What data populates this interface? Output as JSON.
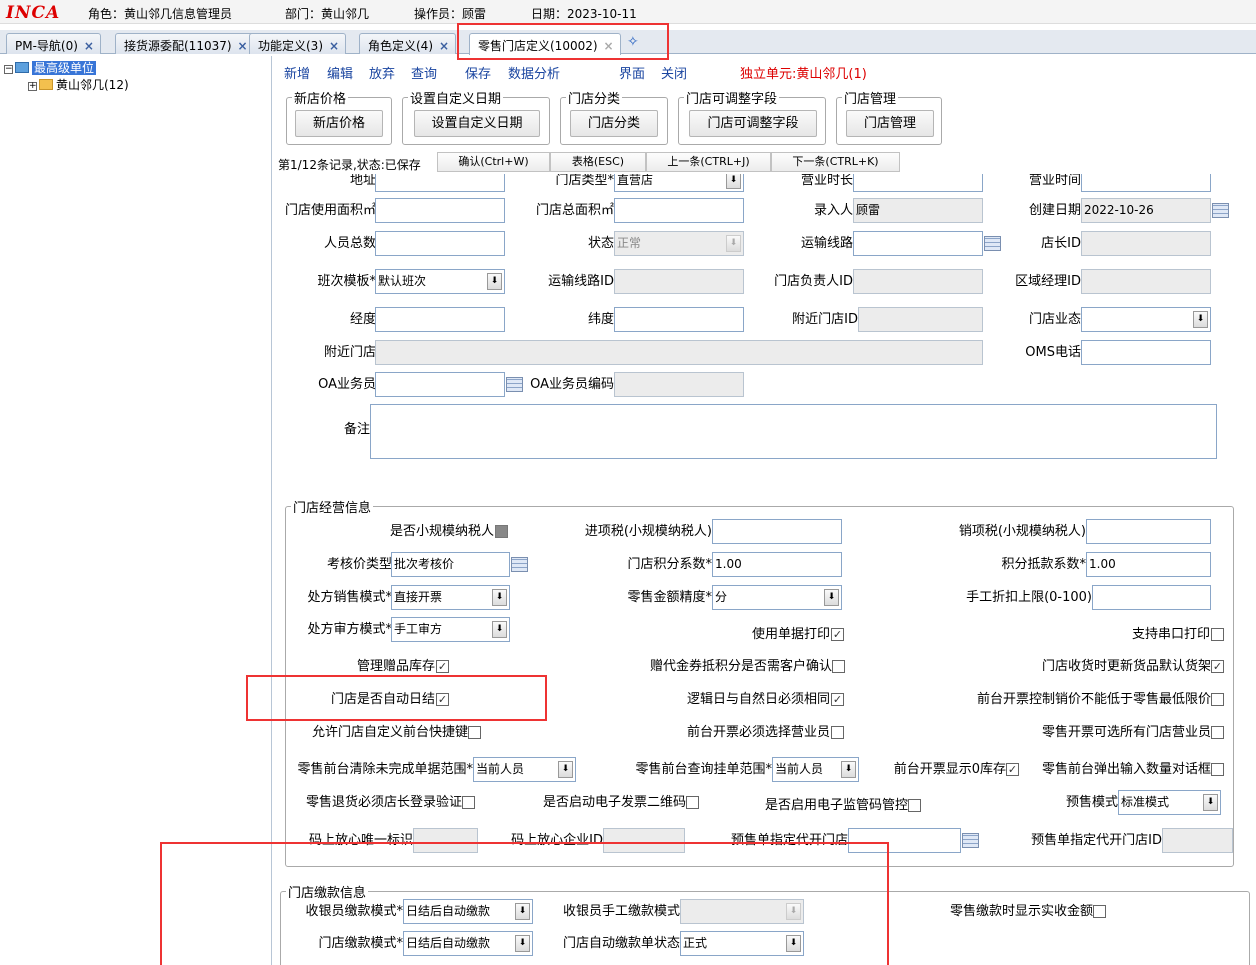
{
  "header": {
    "logo": "INCA",
    "role": "角色：黄山邻几信息管理员",
    "dept": "部门：黄山邻几",
    "operator": "操作员：顾雷",
    "date": "日期：2023-10-11"
  },
  "tabs": [
    {
      "label": "PM-导航(0)"
    },
    {
      "label": "接货源委配(11037)"
    },
    {
      "label": "功能定义(3)"
    },
    {
      "label": "角色定义(4)"
    },
    {
      "label": "零售门店定义(10002)"
    }
  ],
  "tab_close": "×",
  "add_tab": "✧",
  "tree": {
    "root": "最高级单位",
    "child": "黄山邻几(12)",
    "expand_root": "−",
    "expand_child": "+"
  },
  "toolbar": {
    "items": [
      "新增",
      "编辑",
      "放弃",
      "查询",
      "保存",
      "数据分析",
      "界面",
      "关闭"
    ],
    "unit": "独立单元:黄山邻几(1)"
  },
  "groups": [
    {
      "legend": "新店价格",
      "button": "新店价格"
    },
    {
      "legend": "设置自定义日期",
      "button": "设置自定义日期"
    },
    {
      "legend": "门店分类",
      "button": "门店分类"
    },
    {
      "legend": "门店可调整字段",
      "button": "门店可调整字段"
    },
    {
      "legend": "门店管理",
      "button": "门店管理"
    }
  ],
  "record_bar": {
    "status": "第1/12条记录,状态:已保存",
    "confirm": "确认(Ctrl+W)",
    "table": "表格(ESC)",
    "prev": "上一条(CTRL+J)",
    "next": "下一条(CTRL+K)"
  },
  "basic": {
    "address_label": "地址",
    "store_type_label": "门店类型*",
    "store_type_value": "直营店",
    "hours_label": "营业时长",
    "business_time_label": "营业时间",
    "use_area_label": "门店使用面积㎡",
    "total_area_label": "门店总面积㎡",
    "entered_by_label": "录入人",
    "entered_by_value": "顾雷",
    "created_date_label": "创建日期",
    "created_date_value": "2022-10-26",
    "staff_total_label": "人员总数",
    "state_label": "状态",
    "state_value": "正常",
    "route_label": "运输线路",
    "manager_id_label": "店长ID",
    "shift_template_label": "班次模板*",
    "shift_template_value": "默认班次",
    "route_id_label": "运输线路ID",
    "store_owner_id_label": "门店负责人ID",
    "area_manager_id_label": "区域经理ID",
    "longitude_label": "经度",
    "latitude_label": "纬度",
    "nearby_store_id_label": "附近门店ID",
    "store_status_label": "门店业态",
    "nearby_store_label": "附近门店",
    "oms_phone_label": "OMS电话",
    "oa_staff_label": "OA业务员",
    "oa_staff_code_label": "OA业务员编码",
    "remark_label": "备注"
  },
  "ops": {
    "legend": "门店经营信息",
    "small_taxpayer_label": "是否小规模纳税人",
    "input_tax_label": "进项税(小规模纳税人)",
    "output_tax_label": "销项税(小规模纳税人)",
    "check_price_type_label": "考核价类型",
    "check_price_type_value": "批次考核价",
    "points_factor_label": "门店积分系数*",
    "points_factor_value": "1.00",
    "points_offset_label": "积分抵款系数*",
    "points_offset_value": "1.00",
    "rx_sale_mode_label": "处方销售模式*",
    "rx_sale_mode_value": "直接开票",
    "amount_precision_label": "零售金额精度*",
    "amount_precision_value": "分",
    "manual_discount_label": "手工折扣上限(0-100)",
    "rx_review_mode_label": "处方审方模式*",
    "rx_review_mode_value": "手工审方",
    "use_receipt_print_label": "使用单据打印",
    "serial_print_label": "支持串口打印",
    "gift_stock_label": "管理赠品库存",
    "voucher_confirm_label": "赠代金券抵积分是否需客户确认",
    "update_shelf_label": "门店收货时更新货品默认货架",
    "auto_close_label": "门店是否自动日结",
    "logic_date_label": "逻辑日与自然日必须相同",
    "min_price_label": "前台开票控制销价不能低于零售最低限价",
    "custom_shortcut_label": "允许门店自定义前台快捷键",
    "must_select_clerk_label": "前台开票必须选择营业员",
    "all_clerks_label": "零售开票可选所有门店营业员",
    "clear_scope_label": "零售前台清除未完成单据范围*",
    "clear_scope_value": "当前人员",
    "query_scope_label": "零售前台查询挂单范围*",
    "query_scope_value": "当前人员",
    "show_zero_stock_label": "前台开票显示0库存",
    "qty_dialog_label": "零售前台弹出输入数量对话框",
    "return_verify_label": "零售退货必须店长登录验证",
    "einvoice_qr_label": "是否启动电子发票二维码",
    "supervision_code_label": "是否启用电子监管码管控",
    "presale_mode_label": "预售模式",
    "presale_mode_value": "标准模式",
    "code_label_label": "码上放心唯一标识",
    "code_enterprise_label": "码上放心企业ID",
    "presale_store_label": "预售单指定代开门店",
    "presale_store_id_label": "预售单指定代开门店ID"
  },
  "payment": {
    "legend": "门店缴款信息",
    "cashier_mode_label": "收银员缴款模式*",
    "cashier_mode_value": "日结后自动缴款",
    "cashier_manual_label": "收银员手工缴款模式",
    "show_actual_label": "零售缴款时显示实收金额",
    "store_mode_label": "门店缴款模式*",
    "store_mode_value": "日结后自动缴款",
    "auto_state_label": "门店自动缴款单状态",
    "auto_state_value": "正式"
  },
  "symbols": {
    "arrow": "⬇",
    "check": "✓"
  }
}
